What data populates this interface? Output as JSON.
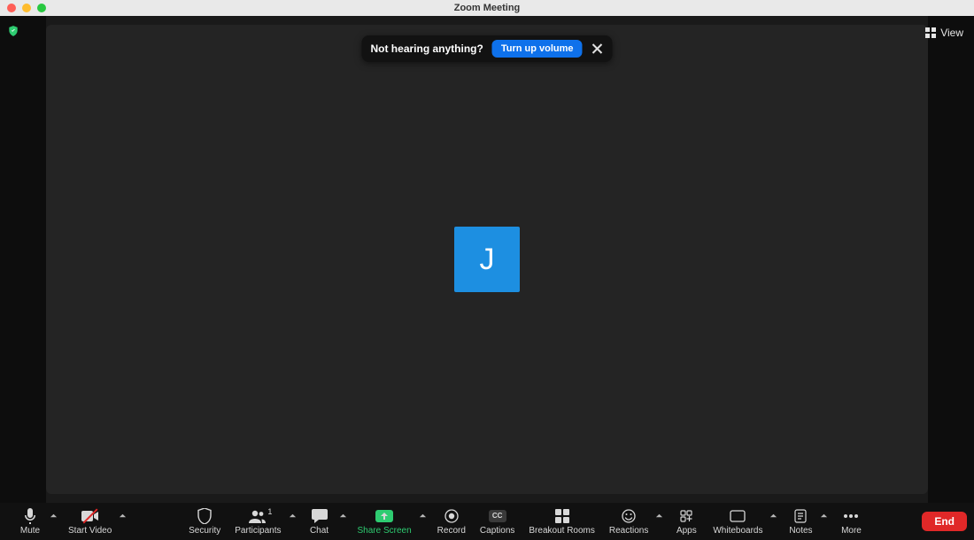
{
  "titlebar": {
    "title": "Zoom Meeting"
  },
  "topRight": {
    "view_label": "View"
  },
  "toast": {
    "message": "Not hearing anything?",
    "action_label": "Turn up volume"
  },
  "participant": {
    "avatar_initial": "J"
  },
  "toolbar": {
    "mute": "Mute",
    "start_video": "Start Video",
    "security": "Security",
    "participants": "Participants",
    "participants_count": "1",
    "chat": "Chat",
    "share_screen": "Share Screen",
    "record": "Record",
    "captions": "Captions",
    "captions_badge": "CC",
    "breakout_rooms": "Breakout Rooms",
    "reactions": "Reactions",
    "apps": "Apps",
    "whiteboards": "Whiteboards",
    "notes": "Notes",
    "more": "More",
    "end": "End"
  }
}
